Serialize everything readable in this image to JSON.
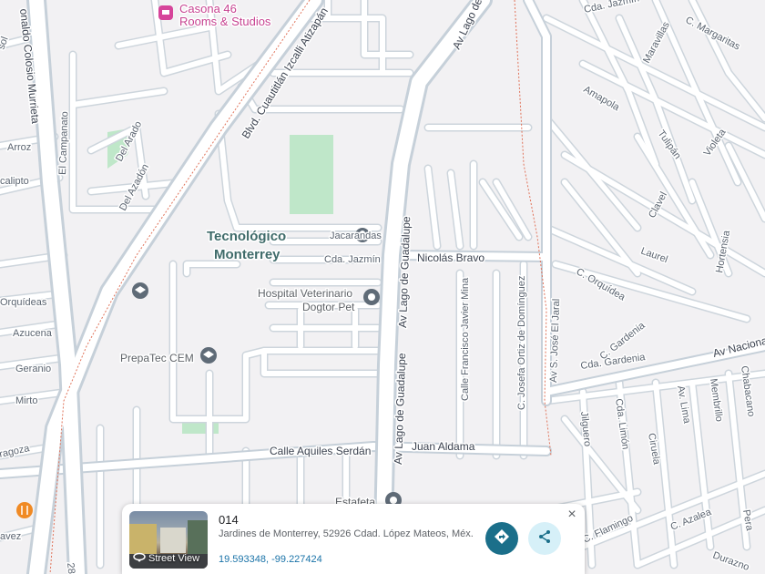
{
  "map": {
    "colors": {
      "background": "#f2f1f3",
      "park": "#bfe7c9",
      "road": "#ffffff",
      "road_casing": "#c6d0d9",
      "boundary": "#e0735a"
    },
    "labels": {
      "casona_line1": "Casona 46",
      "casona_line2": "Rooms & Studios",
      "campus_line1": "Tecnológico",
      "campus_line2": "Monterrey",
      "hospital_line1": "Hospital Veterinario",
      "hospital_line2": "Dogtor Pet",
      "prepatec": "PrepaTec CEM",
      "jacarandas": "Jacarandas",
      "cda_jazmin_center": "Cda. Jazmín",
      "nicolas_bravo": "Nicolás Bravo",
      "calle_aquiles": "Calle Aquiles Serdán",
      "juan_aldama": "Juan Aldama",
      "estafeta": "Estafeta",
      "blvd_cuautitlan": "Blvd. Cuautitlán Izcalli Atizapán",
      "av_lago_guadalupe": "Av Lago de Guadalupe",
      "av_lago_guadalupe_top": "Av Lago de G",
      "calle_francisco": "Calle Francisco Javier Mina",
      "c_josefa": "C. Josefa Ortiz de Domínguez",
      "av_s_jose": "Av S. José El Jaral",
      "colosio": "onaldo Colosio Murrieta",
      "el_campanato": "El Campanato",
      "del_arado": "Del Arado",
      "del_azadon": "Del Azadón",
      "arroz": "Arroz",
      "calipto": "calipto",
      "orquideas": "Orquídeas",
      "azucena": "Azucena",
      "geranio": "Geranio",
      "mirto": "Mirto",
      "ragoza": "ragoza",
      "avez": "avez",
      "sol": "sol",
      "cda_jazmin_top": "Cda. Jazmín",
      "maravillas": "Maravillas",
      "c_margaritas": "C. Margaritas",
      "amapola": "Amapola",
      "tulipan": "Tulipán",
      "violeta": "Violeta",
      "clavel": "Clavel",
      "laurel": "Laurel",
      "hortensia": "Hortensia",
      "c_orquidea": "C. Orquídea",
      "av_nacional": "Av Nacional",
      "cda_gardenia": "Cda. Gardenia",
      "c_gardenia": "C. Gardenia",
      "membrillo": "Membrillo",
      "chabacano": "Chabacano",
      "jilguero": "Jilguero",
      "cda_limon": "Cda. Limón",
      "av_lima": "Av. Lima",
      "ciruela": "Ciruela",
      "c_flamingo": "C. Flamingo",
      "c_azalea": "C. Azalea",
      "pera": "Pera",
      "durazno": "Durazno",
      "num_28": "28"
    }
  },
  "card": {
    "title": "014",
    "address": "Jardines de Monterrey, 52926 Cdad. López Mateos, Méx.",
    "coordinates": "19.593348, -99.227424",
    "street_view_label": "Street View",
    "close_label": "×"
  }
}
